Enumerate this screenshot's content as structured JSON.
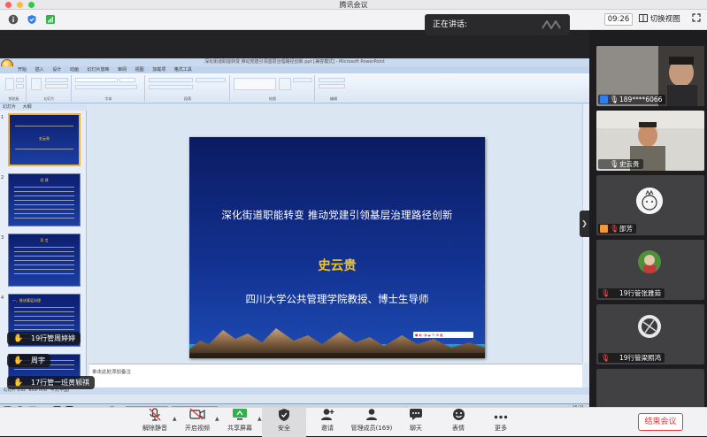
{
  "window": {
    "title": "腾讯会议"
  },
  "topbar": {
    "speaking_label": "正在讲话:",
    "timer": "09:26",
    "switch_view_label": "切换视图"
  },
  "ppt": {
    "window_title": "深化街道职能转变 推动党建引领基层治理路径创新.ppt [兼容模式] - Microsoft PowerPoint",
    "tabs": [
      "开始",
      "插入",
      "设计",
      "动画",
      "幻灯片放映",
      "审阅",
      "视图",
      "加载项",
      "格式工具"
    ],
    "panel_tabs": [
      "幻灯片",
      "大纲"
    ],
    "ribbon_groups": [
      "剪贴板",
      "幻灯片",
      "字体",
      "段落",
      "绘图",
      "编辑"
    ],
    "slide": {
      "title": "深化街道职能转变 推动党建引领基层治理路径创新",
      "name": "史云贵",
      "affiliation": "四川大学公共管理学院教授、博士生导师"
    },
    "thumb_headings": [
      "史云贵",
      "党 建",
      "导 言",
      "一、推进基层治理"
    ],
    "notes_placeholder": "单击此处添加备注",
    "status_text": "幻灯片 1/32 \"Blue Hills\" 中文(中国)",
    "taskbar_items": [
      "课件.ppt",
      "Microsoft Po..."
    ],
    "clock": "15:21"
  },
  "overlay_names": [
    {
      "name": "19行管周婷婷"
    },
    {
      "name": "周宇"
    },
    {
      "name": "17行管一班黄颖祺"
    }
  ],
  "participants": [
    {
      "name": "189****6066",
      "host": true,
      "muted": false
    },
    {
      "name": "史云贵",
      "host": false,
      "muted": false
    },
    {
      "name": "邵芳",
      "host": true,
      "muted": true
    },
    {
      "name": "19行管张雅茹",
      "host": false,
      "muted": true
    },
    {
      "name": "19行管梁照鸿",
      "host": false,
      "muted": true
    }
  ],
  "toolbar": {
    "items": [
      "解除静音",
      "开启视频",
      "共享屏幕",
      "安全",
      "邀请",
      "管理成员(169)",
      "聊天",
      "表情",
      "更多"
    ],
    "end_label": "结束会议"
  },
  "colors": {
    "accent_blue": "#2e7ff2",
    "end_red": "#e03b3b",
    "slide_bg": "#12318f",
    "slide_name": "#f3c31f"
  }
}
